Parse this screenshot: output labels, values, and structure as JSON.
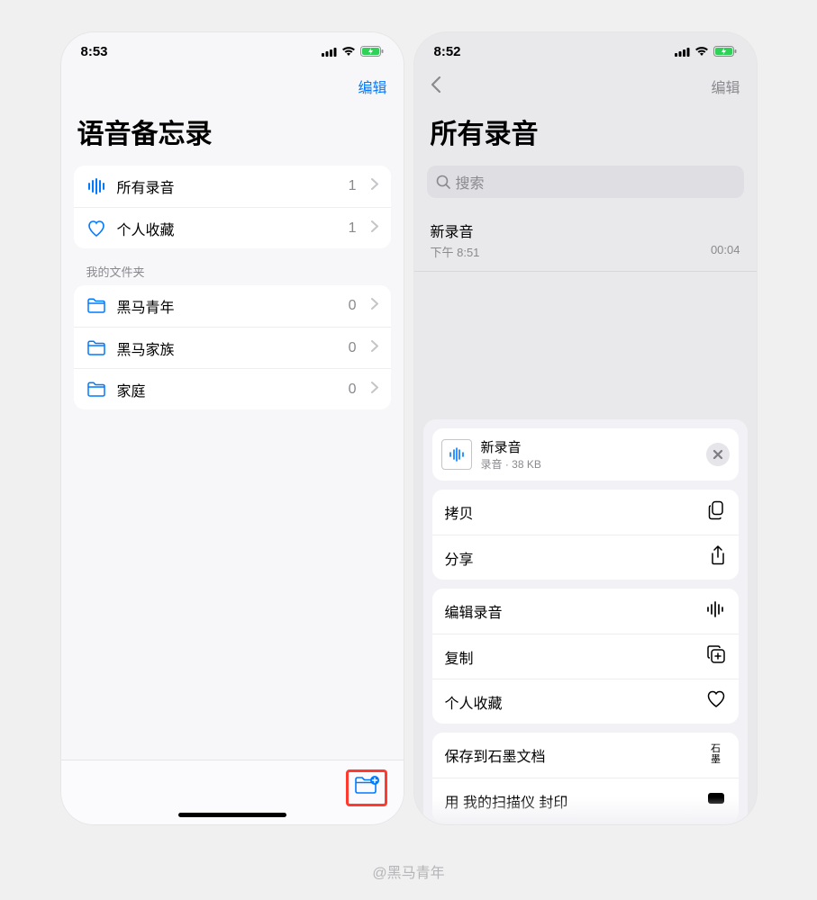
{
  "caption": "@黑马青年",
  "left": {
    "status_time": "8:53",
    "nav_edit": "编辑",
    "title": "语音备忘录",
    "main_rows": [
      {
        "icon": "waveform-icon",
        "label": "所有录音",
        "count": "1"
      },
      {
        "icon": "heart-icon",
        "label": "个人收藏",
        "count": "1"
      }
    ],
    "folders_header": "我的文件夹",
    "folders": [
      {
        "label": "黑马青年",
        "count": "0"
      },
      {
        "label": "黑马家族",
        "count": "0"
      },
      {
        "label": "家庭",
        "count": "0"
      }
    ]
  },
  "right": {
    "status_time": "8:52",
    "nav_edit": "编辑",
    "title": "所有录音",
    "search_placeholder": "搜索",
    "recording": {
      "title": "新录音",
      "time": "下午 8:51",
      "duration": "00:04"
    },
    "sheet": {
      "file_title": "新录音",
      "file_sub": "录音 · 38 KB",
      "group1": [
        {
          "label": "拷贝",
          "icon": "copy-doc-icon"
        },
        {
          "label": "分享",
          "icon": "share-icon"
        }
      ],
      "group2": [
        {
          "label": "编辑录音",
          "icon": "waveform-icon"
        },
        {
          "label": "复制",
          "icon": "duplicate-icon"
        },
        {
          "label": "个人收藏",
          "icon": "heart-outline-icon"
        }
      ],
      "group3": [
        {
          "label": "保存到石墨文档",
          "icon": "shimo-icon"
        },
        {
          "label": "用 我的扫描仪 封印",
          "icon": "scanner-icon"
        }
      ]
    }
  }
}
